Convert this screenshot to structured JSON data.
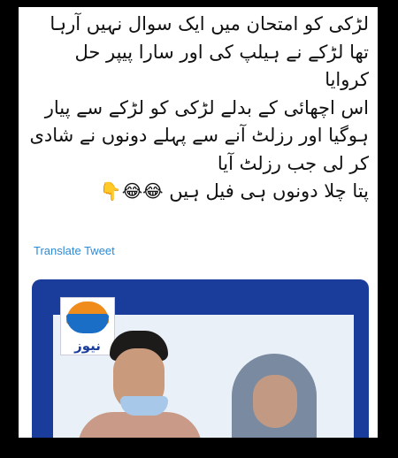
{
  "tweet": {
    "lines": [
      "لڑکی کو امتحان میں ایک سوال نہیں آرہا",
      "تھا لڑکے نے ہیلپ کی اور سارا پیپر حل",
      "کروایا",
      "اس اچھائی کے بدلے لڑکی کو لڑکے سے پیار",
      "ہوگیا اور رزلٹ آنے سے پہلے دونوں نے شادی",
      "کر لی جب رزلٹ آیا",
      "پتا چلا دونوں ہی فیل ہیں"
    ],
    "emojis": "😂😂👇",
    "translate_label": "Translate Tweet"
  },
  "media": {
    "logo_text": "نیوز"
  },
  "colors": {
    "background": "#000000",
    "card": "#ffffff",
    "link": "#2a8bd8",
    "media_frame": "#1a3c9a"
  }
}
